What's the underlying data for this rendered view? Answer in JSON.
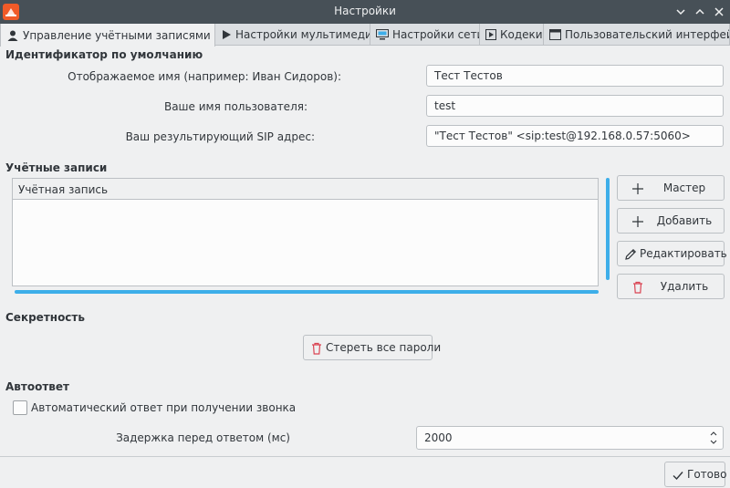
{
  "window": {
    "title": "Настройки"
  },
  "tabs": [
    {
      "label": "Управление учётными записями SIP",
      "icon": "user-icon"
    },
    {
      "label": "Настройки мультимедиа",
      "icon": "play-icon"
    },
    {
      "label": "Настройки сети",
      "icon": "network-icon"
    },
    {
      "label": "Кодеки",
      "icon": "codec-icon"
    },
    {
      "label": "Пользовательский интерфейс",
      "icon": "window-icon"
    }
  ],
  "identity": {
    "title": "Идентификатор по умолчанию",
    "display_name_label": "Отображаемое имя (например: Иван Сидоров):",
    "display_name_value": "Тест Тестов",
    "username_label": "Ваше имя пользователя:",
    "username_value": "test",
    "sip_address_label": "Ваш результирующий SIP адрес:",
    "sip_address_value": "\"Тест Тестов\" <sip:test@192.168.0.57:5060>"
  },
  "accounts": {
    "title": "Учётные записи",
    "column_header": "Учётная запись",
    "buttons": {
      "wizard": "Мастер",
      "add": "Добавить",
      "edit": "Редактировать",
      "delete": "Удалить"
    }
  },
  "privacy": {
    "title": "Секретность",
    "clear_passwords": "Стереть все пароли"
  },
  "autoanswer": {
    "title": "Автоответ",
    "checkbox_label": "Автоматический ответ при получении звонка",
    "delay_label": "Задержка перед ответом (мс)",
    "delay_value": "2000"
  },
  "footer": {
    "done": "Готово"
  },
  "colors": {
    "titlebar": "#475057",
    "accent": "#3daee9",
    "danger": "#da4453"
  }
}
